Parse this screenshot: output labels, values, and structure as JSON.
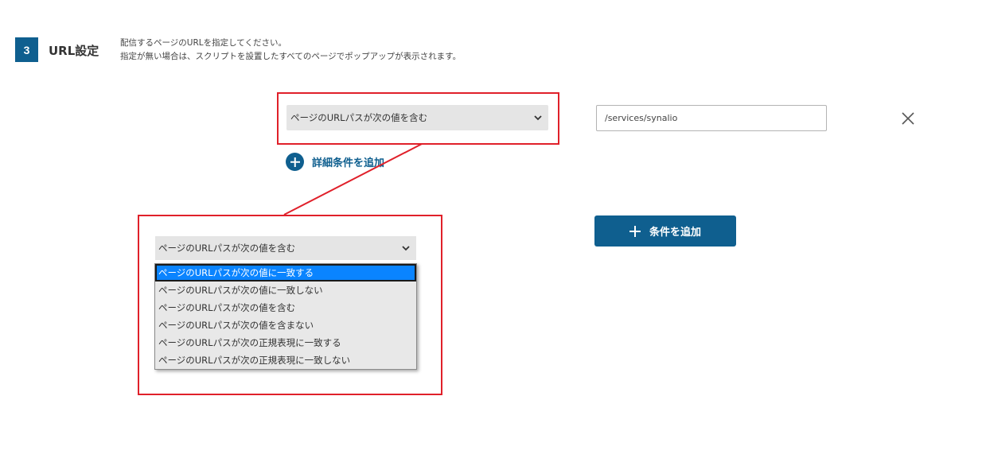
{
  "section": {
    "step_number": "3",
    "title": "URL設定",
    "description_line1": "配信するページのURLを指定してください。",
    "description_line2": "指定が無い場合は、スクリプトを設置したすべてのページでポップアップが表示されます。"
  },
  "condition_row": {
    "selected_condition": "ページのURLパスが次の値を含む",
    "url_value": "/services/synalio",
    "remove_icon": "close-icon"
  },
  "add_detail_label": "詳細条件を追加",
  "add_condition_label": "条件を追加",
  "zoom": {
    "selected_condition": "ページのURLパスが次の値を含む",
    "options": [
      "ページのURLパスが次の値に一致する",
      "ページのURLパスが次の値に一致しない",
      "ページのURLパスが次の値を含む",
      "ページのURLパスが次の値を含まない",
      "ページのURLパスが次の正規表現に一致する",
      "ページのURLパスが次の正規表現に一致しない"
    ],
    "highlighted_index": 0
  },
  "colors": {
    "brand": "#0f5f8f",
    "highlight_border": "#e0202a",
    "option_highlight": "#0a84ff"
  }
}
